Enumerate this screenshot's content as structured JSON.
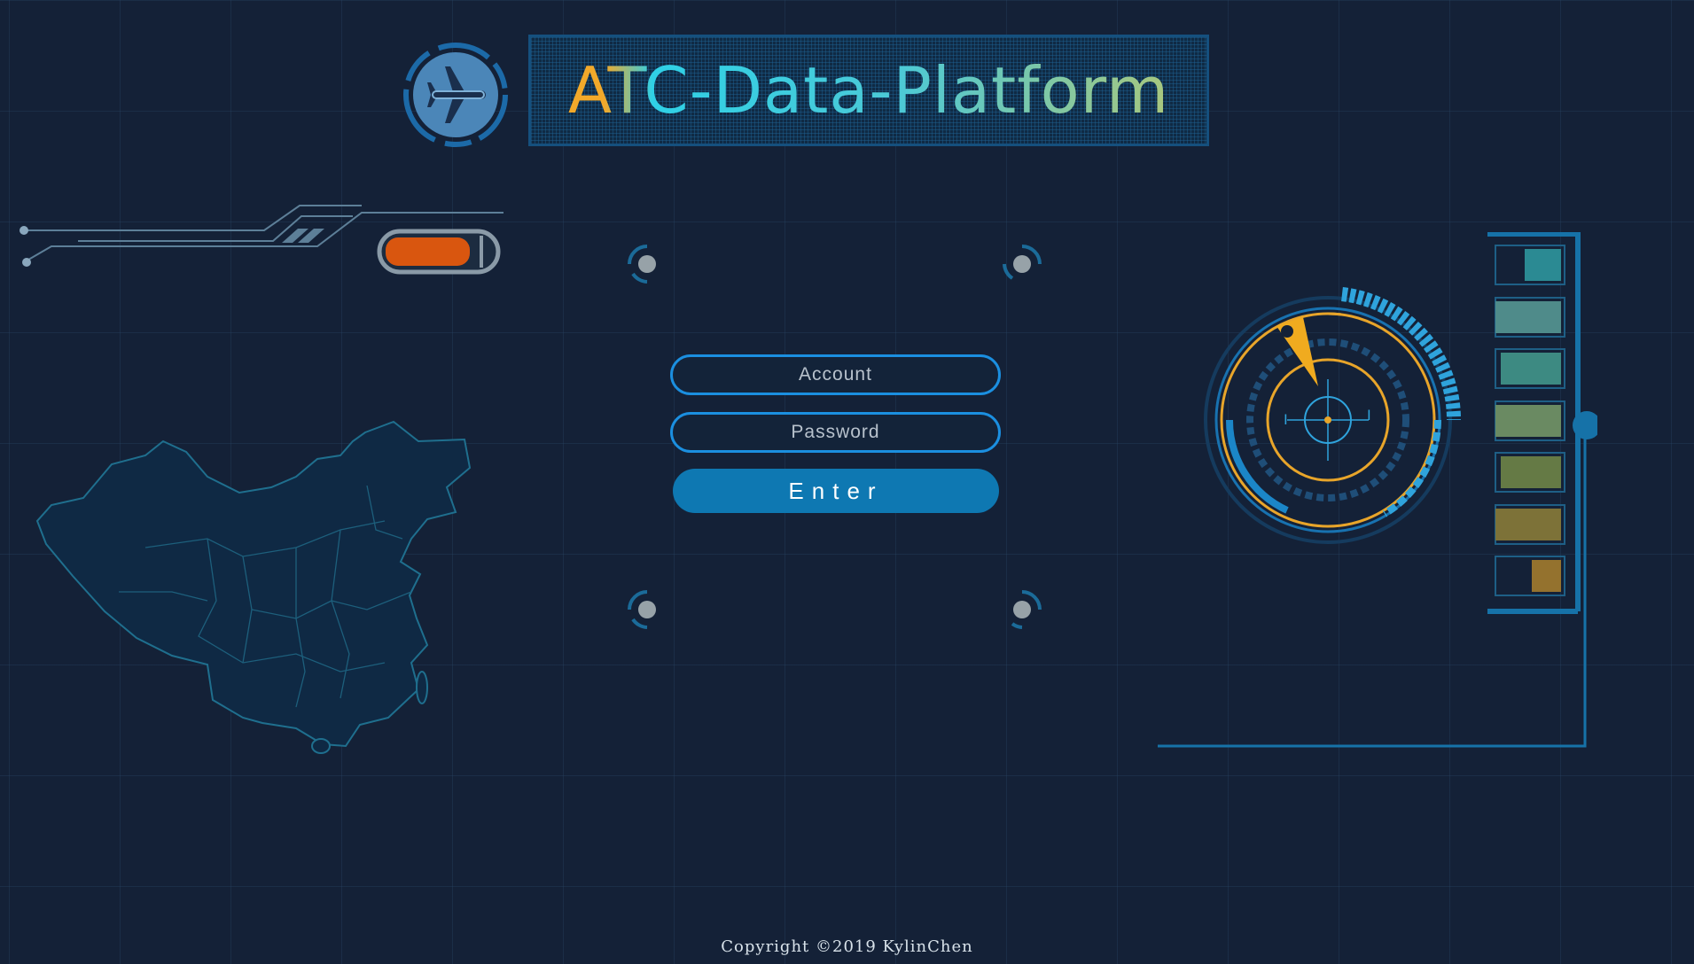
{
  "header": {
    "title": "ATC-Data-Platform"
  },
  "login": {
    "account_placeholder": "Account",
    "password_placeholder": "Password",
    "enter_label": "Enter"
  },
  "footer": {
    "copyright": "Copyright ©2019 KylinChen"
  },
  "decor": {
    "icons": [
      "airplane-icon",
      "battery-icon",
      "radar-gauge-icon",
      "china-map"
    ],
    "level_bars": [
      {
        "level": 0.55,
        "color": "#2b8a93"
      },
      {
        "level": 1.0,
        "color": "#4f8b8a"
      },
      {
        "level": 0.92,
        "color": "#3d8a82"
      },
      {
        "level": 1.0,
        "color": "#6a8a62"
      },
      {
        "level": 0.92,
        "color": "#657a45"
      },
      {
        "level": 1.0,
        "color": "#7d7238"
      },
      {
        "level": 0.45,
        "color": "#94722e"
      }
    ],
    "battery_level": 0.7
  },
  "colors": {
    "accent": "#1b8fe0",
    "button": "#0e78b2",
    "background": "#142137",
    "orange": "#d9560f",
    "gold": "#f2a92a"
  }
}
